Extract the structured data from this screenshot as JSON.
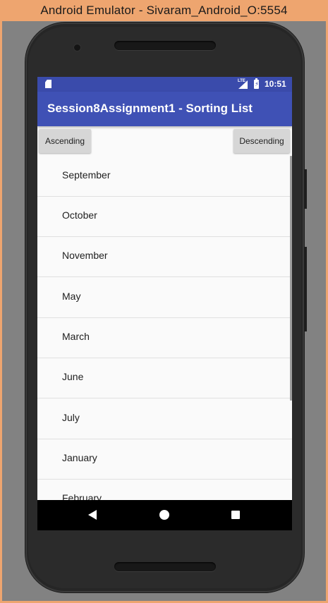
{
  "window": {
    "title": "Android Emulator - Sivaram_Android_O:5554"
  },
  "status_bar": {
    "network": "LTE",
    "time": "10:51",
    "icons": [
      "sd-card-icon",
      "signal-icon",
      "battery-charging-icon"
    ]
  },
  "app_bar": {
    "title": "Session8Assignment1 - Sorting List"
  },
  "buttons": {
    "ascending": "Ascending",
    "descending": "Descending"
  },
  "list": {
    "items": [
      "September",
      "October",
      "November",
      "May",
      "March",
      "June",
      "July",
      "January",
      "February"
    ]
  },
  "nav_bar": {
    "icons": [
      "back-icon",
      "home-icon",
      "recents-icon"
    ]
  },
  "colors": {
    "status_bar": "#3a4bab",
    "app_bar": "#3f51b5",
    "window_frame": "#eea56f"
  }
}
